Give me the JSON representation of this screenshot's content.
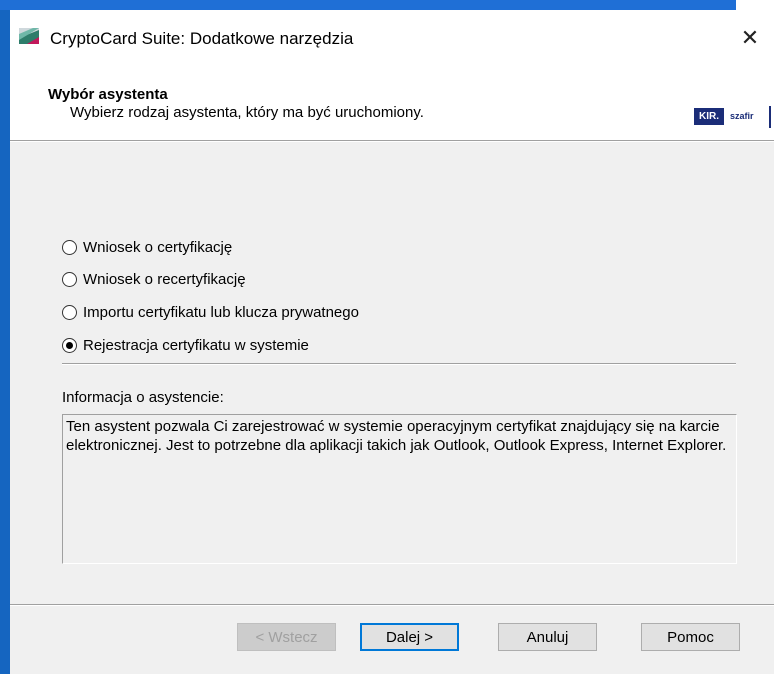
{
  "window": {
    "title": "CryptoCard Suite: Dodatkowe narzędzia",
    "close_glyph": "✕"
  },
  "header": {
    "title": "Wybór asystenta",
    "subtitle": "Wybierz rodzaj asystenta, który ma być uruchomiony.",
    "logo_left": "KIR.",
    "logo_right": "szafir"
  },
  "options": [
    {
      "label": "Wniosek o certyfikację",
      "checked": false
    },
    {
      "label": "Wniosek o recertyfikację",
      "checked": false
    },
    {
      "label": "Importu certyfikatu lub klucza prywatnego",
      "checked": false
    },
    {
      "label": "Rejestracja certyfikatu w systemie",
      "checked": true
    }
  ],
  "info": {
    "label": "Informacja o asystencie:",
    "text": "Ten asystent pozwala Ci zarejestrować w systemie operacyjnym certyfikat znajdujący się na karcie elektronicznej. Jest to potrzebne dla aplikacji takich jak Outlook, Outlook Express, Internet Explorer."
  },
  "buttons": {
    "back": "< Wstecz",
    "next": "Dalej >",
    "cancel": "Anuluj",
    "help": "Pomoc"
  },
  "icons": {
    "app": "cryptocard-app-icon",
    "close": "close-icon"
  },
  "colors": {
    "accent": "#0078d7",
    "panel": "#f0f0f0",
    "logo": "#1b2d78"
  }
}
